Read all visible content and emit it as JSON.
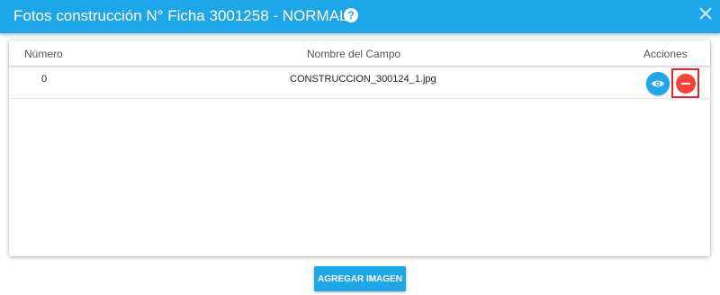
{
  "dialog": {
    "title": "Fotos construcción N° Ficha 3001258 - NORMAL",
    "help_icon": "question-circle-icon",
    "help_glyph": "?",
    "close_icon": "close-icon"
  },
  "table": {
    "columns": [
      "Número",
      "Nombre del Campo",
      "Acciones"
    ],
    "rows": [
      {
        "numero": "0",
        "nombre": "CONSTRUCCION_300124_1.jpg",
        "actions": [
          "eye-icon",
          "minus-icon"
        ]
      }
    ]
  },
  "footer": {
    "add_label": "AGREGAR IMAGEN"
  },
  "colors": {
    "header": "#1ea7e8",
    "view_button": "#1ea7e8",
    "delete_button": "#f44336",
    "highlight_border": "#e5252a"
  }
}
